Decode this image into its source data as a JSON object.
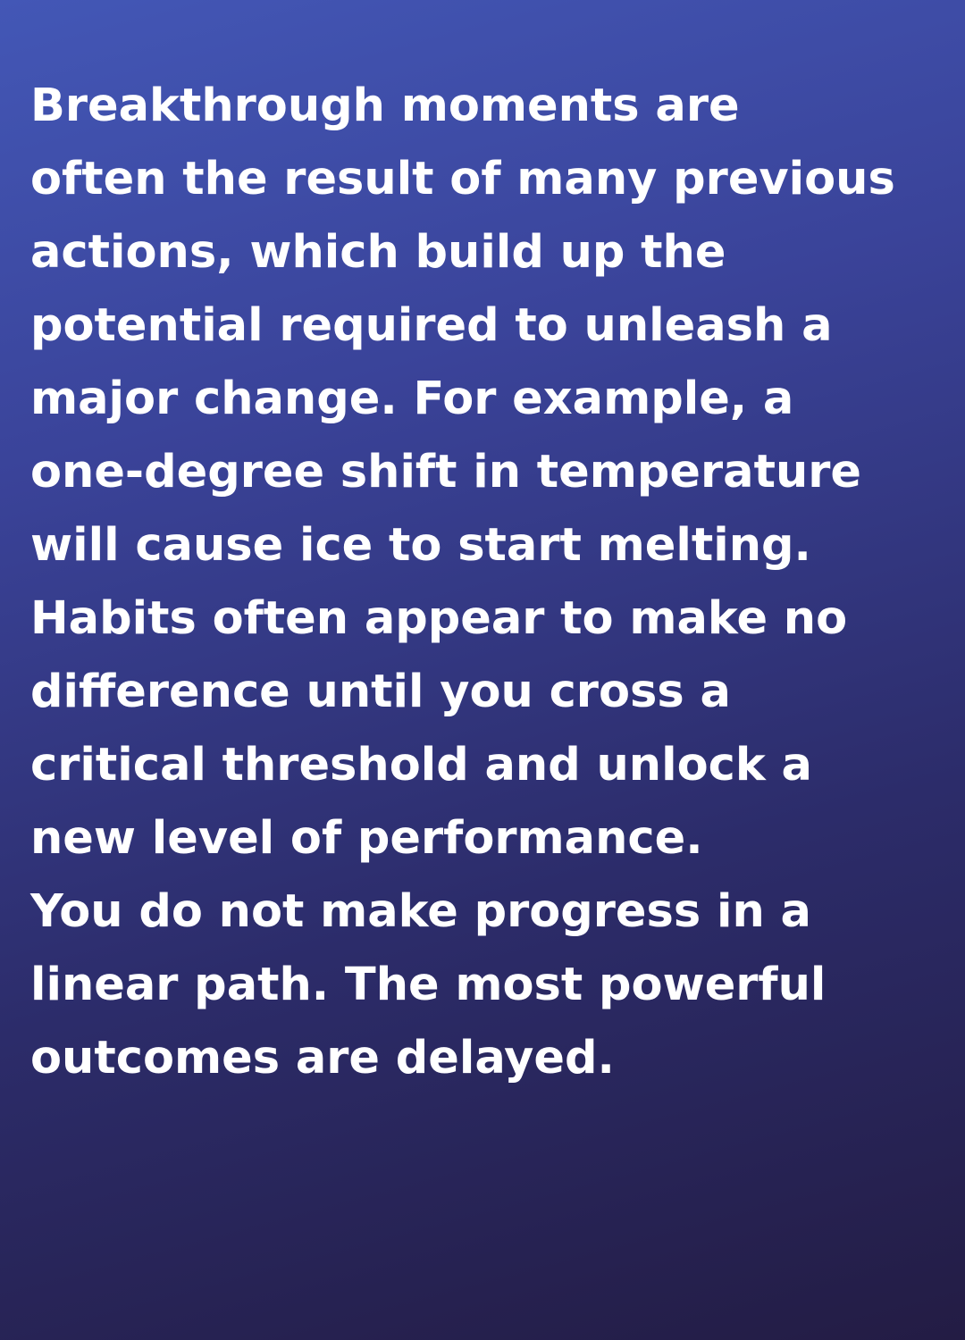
{
  "background": {
    "gradient_start": "#4357b6",
    "gradient_end": "#231c44"
  },
  "text_color": "#ffffff",
  "quote": {
    "lines": [
      "Breakthrough moments are",
      "often the result of many previous",
      "actions, which build up the",
      "potential required to unleash a",
      "major change. For example, a",
      "one-degree shift in temperature",
      "will cause ice to start melting.",
      "Habits often appear to make no",
      "difference until you cross a",
      "critical threshold and unlock a",
      "new level of performance.",
      "You do not make progress in a",
      "linear path. The most powerful",
      "outcomes are delayed."
    ]
  }
}
